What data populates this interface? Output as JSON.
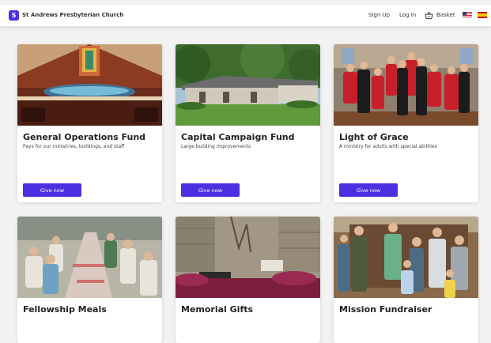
{
  "header": {
    "logo_letter": "S",
    "church_name": "St Andrews Presbyterian Church",
    "signup": "Sign Up",
    "login": "Log In",
    "basket": "Basket",
    "accent": "#4b2fe0"
  },
  "cards": [
    {
      "title": "General Operations Fund",
      "description": "Pays for our ministries, buildings, and staff",
      "button": "Give now"
    },
    {
      "title": "Capital Campaign Fund",
      "description": "Large building improvements",
      "button": "Give now"
    },
    {
      "title": "Light of Grace",
      "description": "A ministry for adults with special abilities",
      "button": "Give now"
    },
    {
      "title": "Fellowship Meals",
      "description": "",
      "button": ""
    },
    {
      "title": "Memorial Gifts",
      "description": "",
      "button": ""
    },
    {
      "title": "Mission Fundraiser",
      "description": "",
      "button": ""
    }
  ]
}
